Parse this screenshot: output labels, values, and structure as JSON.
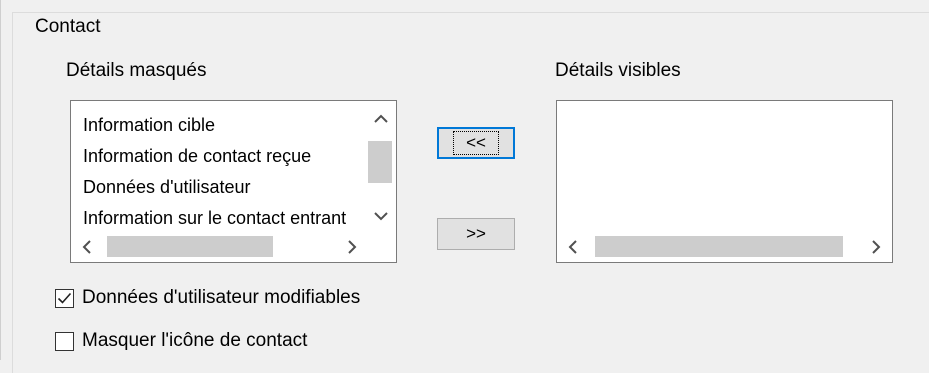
{
  "group": {
    "title": "Contact"
  },
  "hidden_details": {
    "label": "Détails masqués",
    "items": [
      "Information cible",
      "Information de contact reçue",
      "Données d'utilisateur",
      "Information sur le contact entrant"
    ]
  },
  "visible_details": {
    "label": "Détails visibles",
    "items": []
  },
  "buttons": {
    "move_left_label": "<<",
    "move_right_label": ">>"
  },
  "options": {
    "editable_user_data": {
      "label": "Données d'utilisateur modifiables",
      "checked": true
    },
    "hide_contact_icon": {
      "label": "Masquer l'icône de contact",
      "checked": false
    }
  },
  "icons": {
    "scroll_up": "chevron-up-icon",
    "scroll_down": "chevron-down-icon",
    "scroll_left": "chevron-left-icon",
    "scroll_right": "chevron-right-icon",
    "check": "checkmark-icon"
  },
  "colors": {
    "focus_border": "#0078d7",
    "window_bg": "#f0f0f0",
    "scroll_thumb": "#cdcdcd"
  }
}
